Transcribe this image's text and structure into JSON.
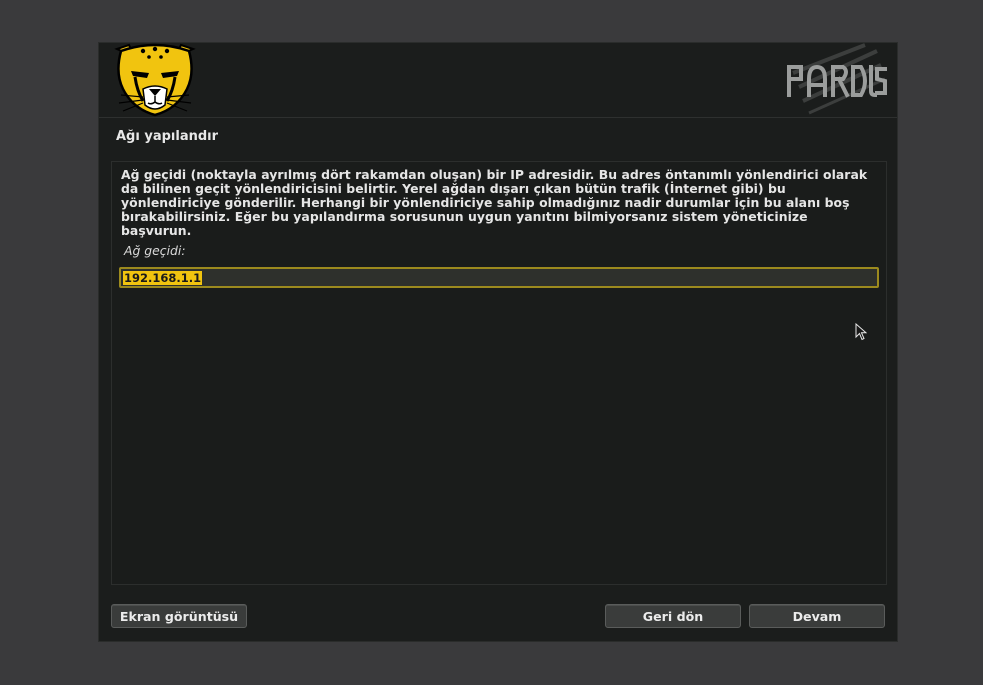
{
  "header": {
    "cheetah_logo": "cheetah-logo",
    "wordmark": "PARDUS"
  },
  "step": {
    "title": "Ağı yapılandır"
  },
  "content": {
    "description": "Ağ geçidi (noktayla ayrılmış dört rakamdan oluşan) bir IP adresidir. Bu adres öntanımlı yönlendirici olarak da bilinen geçit yönlendiricisini belirtir. Yerel ağdan dışarı çıkan bütün trafik (İnternet gibi) bu yönlendiriciye gönderilir. Herhangi bir yönlendiriciye sahip olmadığınız nadir durumlar için bu alanı boş bırakabilirsiniz. Eğer bu yapılandırma sorusunun uygun yanıtını bilmiyorsanız sistem yöneticinize başvurun.",
    "field_label": "Ağ geçidi:",
    "gateway_value": "192.168.1.1"
  },
  "buttons": {
    "screenshot": "Ekran görüntüsü",
    "back": "Geri dön",
    "next": "Devam"
  },
  "colors": {
    "accent": "#f1c40f",
    "background": "#1b1d1c",
    "desktop": "#3a3a3c"
  }
}
